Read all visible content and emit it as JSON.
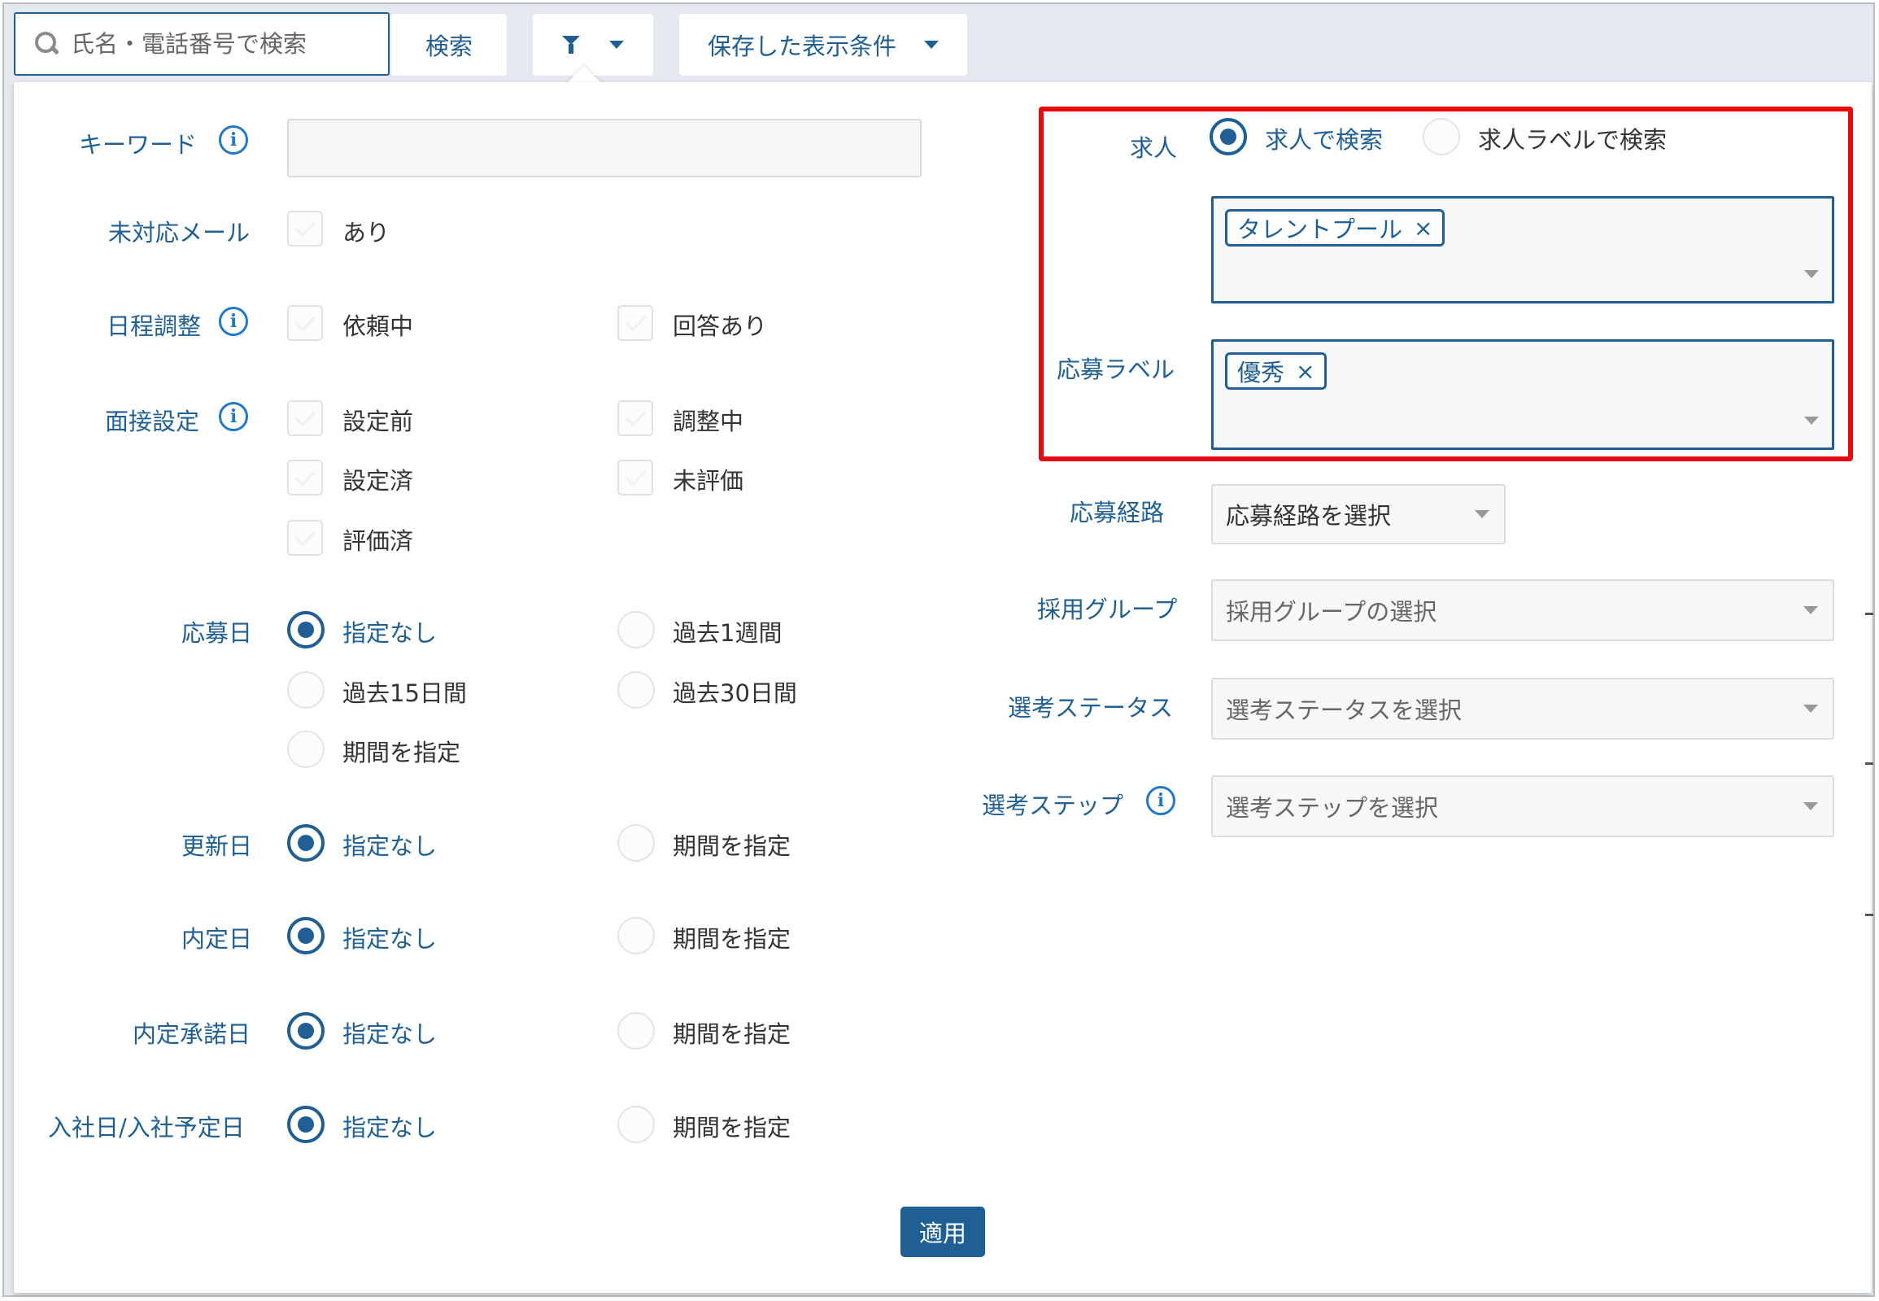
{
  "topbar": {
    "search_placeholder": "氏名・電話番号で検索",
    "search_button": "検索",
    "saved_conditions_label": "保存した表示条件"
  },
  "left": {
    "keyword": {
      "label": "キーワード",
      "value": ""
    },
    "unhandled_mail": {
      "label": "未対応メール",
      "options": [
        "あり"
      ]
    },
    "schedule": {
      "label": "日程調整",
      "options": [
        "依頼中",
        "回答あり"
      ]
    },
    "interview": {
      "label": "面接設定",
      "options": [
        "設定前",
        "調整中",
        "設定済",
        "未評価",
        "評価済"
      ]
    },
    "apply_date": {
      "label": "応募日",
      "options": [
        "指定なし",
        "過去1週間",
        "過去15日間",
        "過去30日間",
        "期間を指定"
      ],
      "selected": "指定なし"
    },
    "updated_date": {
      "label": "更新日",
      "options": [
        "指定なし",
        "期間を指定"
      ],
      "selected": "指定なし"
    },
    "offer_date": {
      "label": "内定日",
      "options": [
        "指定なし",
        "期間を指定"
      ],
      "selected": "指定なし"
    },
    "offer_accept_date": {
      "label": "内定承諾日",
      "options": [
        "指定なし",
        "期間を指定"
      ],
      "selected": "指定なし"
    },
    "join_date": {
      "label": "入社日/入社予定日",
      "options": [
        "指定なし",
        "期間を指定"
      ],
      "selected": "指定なし"
    }
  },
  "right": {
    "job": {
      "label": "求人",
      "options": [
        "求人で検索",
        "求人ラベルで検索"
      ],
      "selected": "求人で検索",
      "tags": [
        "タレントプール"
      ]
    },
    "apply_label": {
      "label": "応募ラベル",
      "tags": [
        "優秀"
      ]
    },
    "apply_route": {
      "label": "応募経路",
      "value": "応募経路を選択"
    },
    "recruit_group": {
      "label": "採用グループ",
      "placeholder": "採用グループの選択"
    },
    "selection_status": {
      "label": "選考ステータス",
      "placeholder": "選考ステータスを選択"
    },
    "selection_step": {
      "label": "選考ステップ",
      "placeholder": "選考ステップを選択"
    }
  },
  "apply_button": "適用",
  "icons": {
    "search": "search-icon",
    "filter": "filter-icon",
    "info": "info-icon",
    "remove": "×"
  },
  "colors": {
    "accent": "#1f5f94",
    "highlight": "#e8090f"
  }
}
